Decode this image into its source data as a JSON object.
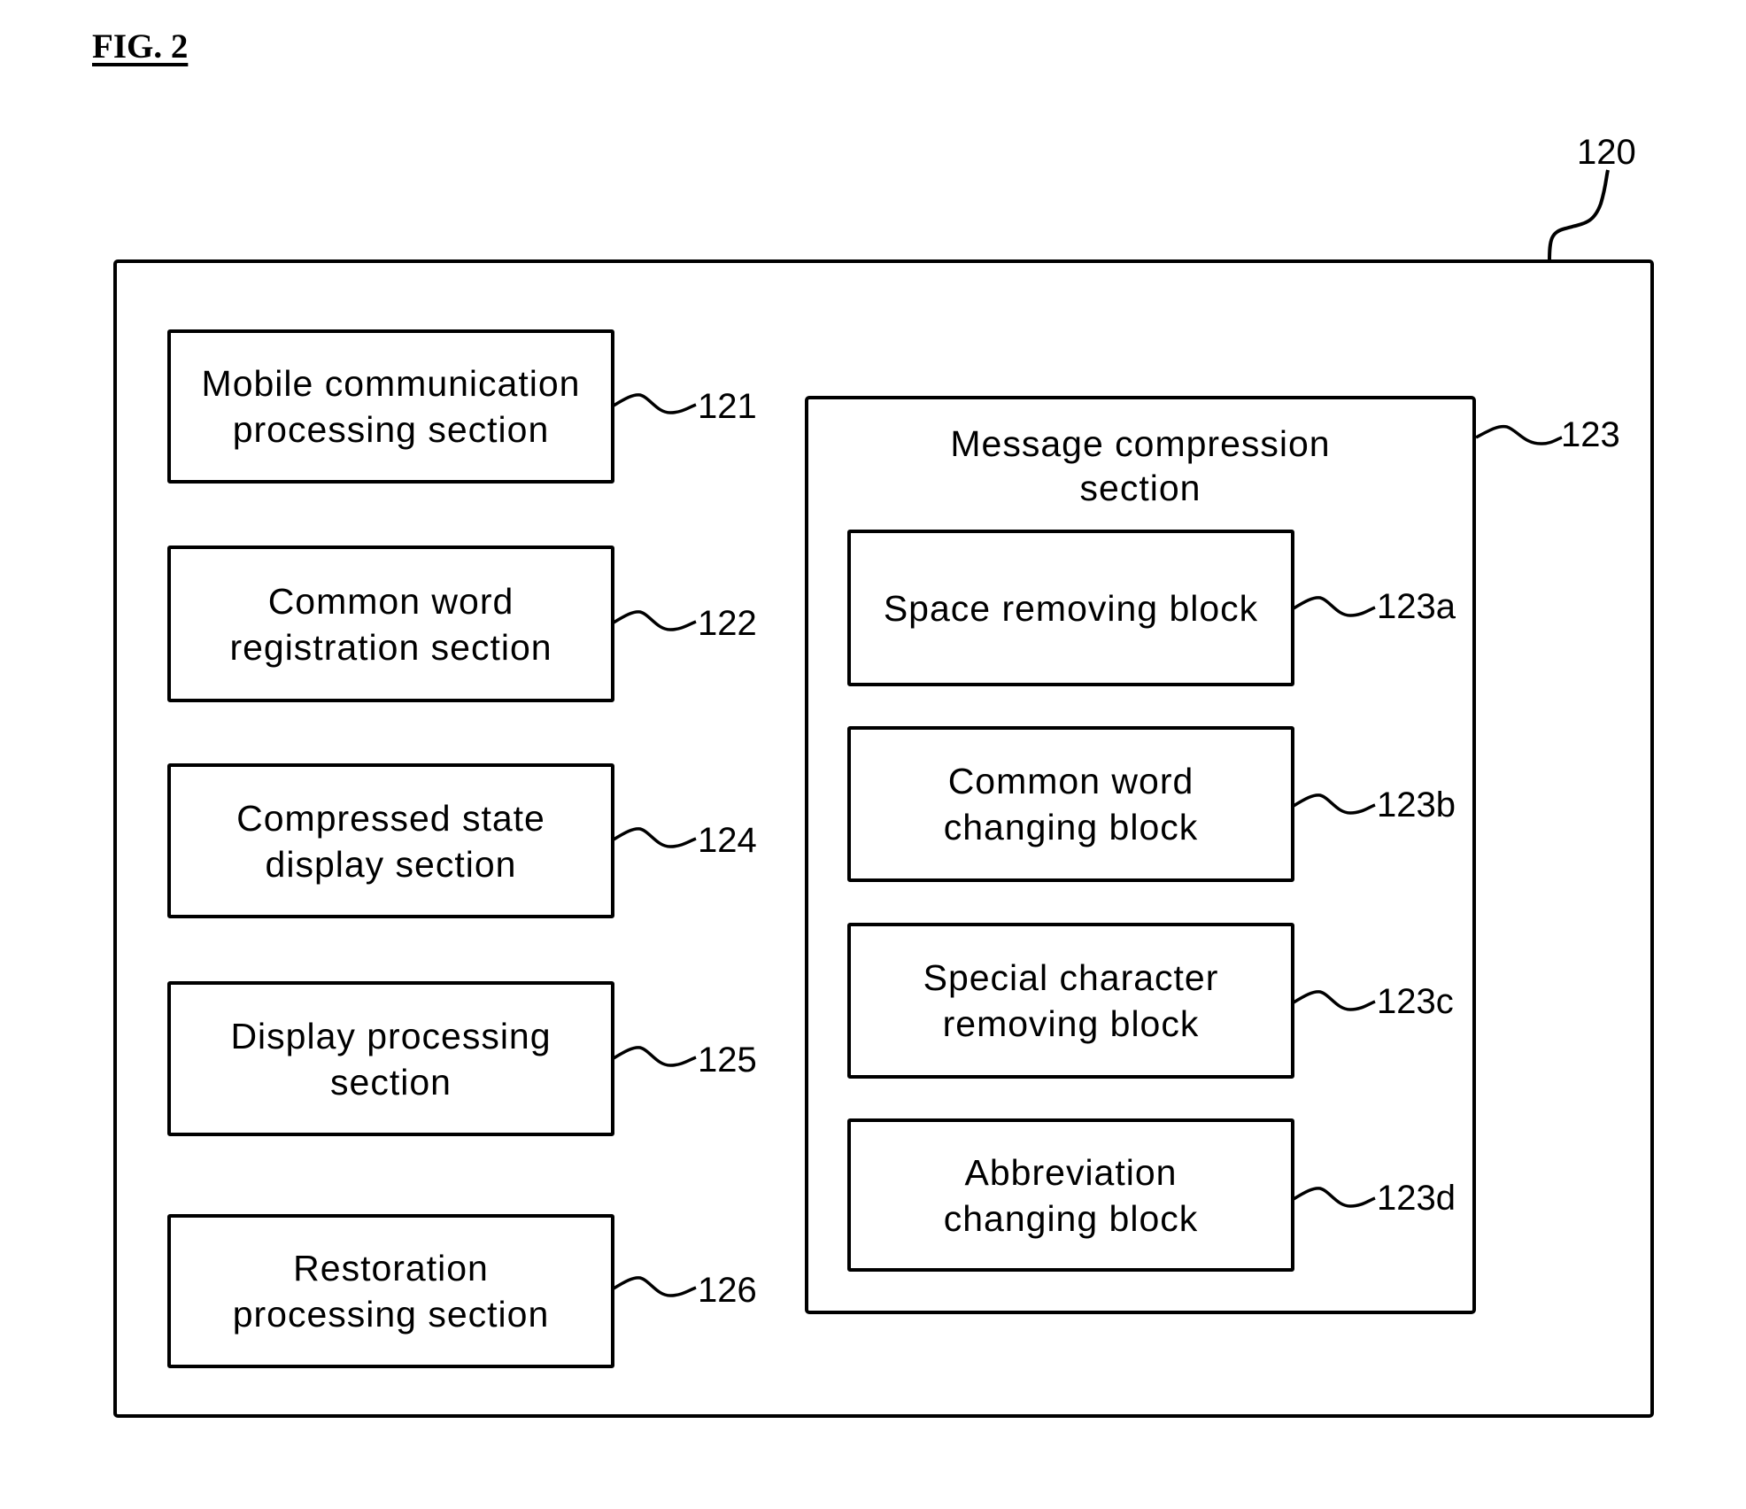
{
  "figure": {
    "title": "FIG. 2"
  },
  "device": {
    "ref": "120"
  },
  "left_sections": [
    {
      "ref": "121",
      "label": "Mobile communication\nprocessing section"
    },
    {
      "ref": "122",
      "label": "Common word\nregistration section"
    },
    {
      "ref": "124",
      "label": "Compressed state\ndisplay section"
    },
    {
      "ref": "125",
      "label": "Display processing\nsection"
    },
    {
      "ref": "126",
      "label": "Restoration\nprocessing section"
    }
  ],
  "message_compression": {
    "ref": "123",
    "label": "Message compression\nsection",
    "blocks": [
      {
        "ref": "123a",
        "label": "Space removing block"
      },
      {
        "ref": "123b",
        "label": "Common word\nchanging block"
      },
      {
        "ref": "123c",
        "label": "Special character\nremoving block"
      },
      {
        "ref": "123d",
        "label": "Abbreviation\nchanging block"
      }
    ]
  }
}
